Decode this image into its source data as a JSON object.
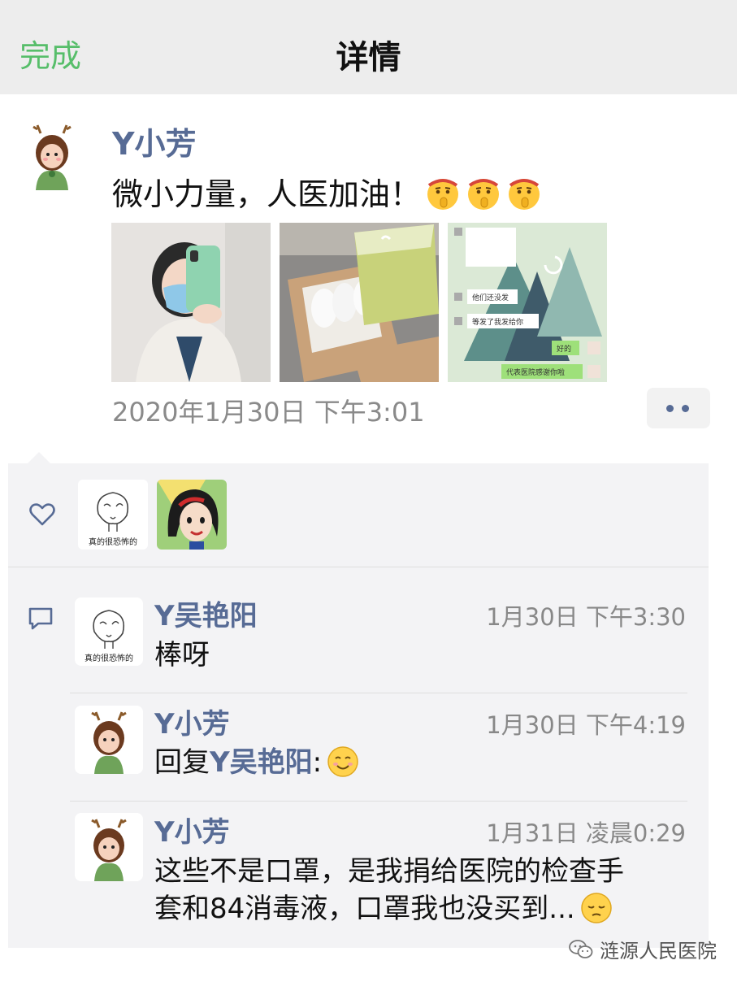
{
  "nav": {
    "done_label": "完成",
    "title": "详情"
  },
  "post": {
    "author": "Y小芳",
    "text": "微小力量，人医加油！",
    "emojis": [
      "shush-emoji",
      "shush-emoji",
      "shush-emoji"
    ],
    "photos": [
      {
        "name": "photo-selfie-with-mask"
      },
      {
        "name": "photo-box-of-supplies"
      },
      {
        "name": "photo-chat-screenshot",
        "lines": [
          "他们还没发",
          "等发了我发给你",
          "好的",
          "代表医院感谢你啦"
        ]
      }
    ],
    "time": "2020年1月30日 下午3:01"
  },
  "likes": {
    "users": [
      {
        "avatar": "sketch-face-avatar",
        "caption": "真的很恐怖的"
      },
      {
        "avatar": "cartoon-princess-avatar"
      }
    ]
  },
  "comments": [
    {
      "name": "Y吴艳阳",
      "time": "1月30日 下午3:30",
      "text": "棒呀",
      "avatar_caption": "真的很恐怖的"
    },
    {
      "name": "Y小芳",
      "time": "1月30日 下午4:19",
      "reply_prefix": "回复",
      "reply_to": "Y吴艳阳",
      "text": ":"
    },
    {
      "name": "Y小芳",
      "time": "1月31日 凌晨0:29",
      "text_line1": "这些不是口罩，是我捐给医院的检查手",
      "text_line2": "套和84消毒液，口罩我也没买到..."
    }
  ],
  "watermark": "涟源人民医院",
  "colors": {
    "link": "#576b95",
    "done": "#57be6a",
    "panel": "#f3f3f5"
  }
}
